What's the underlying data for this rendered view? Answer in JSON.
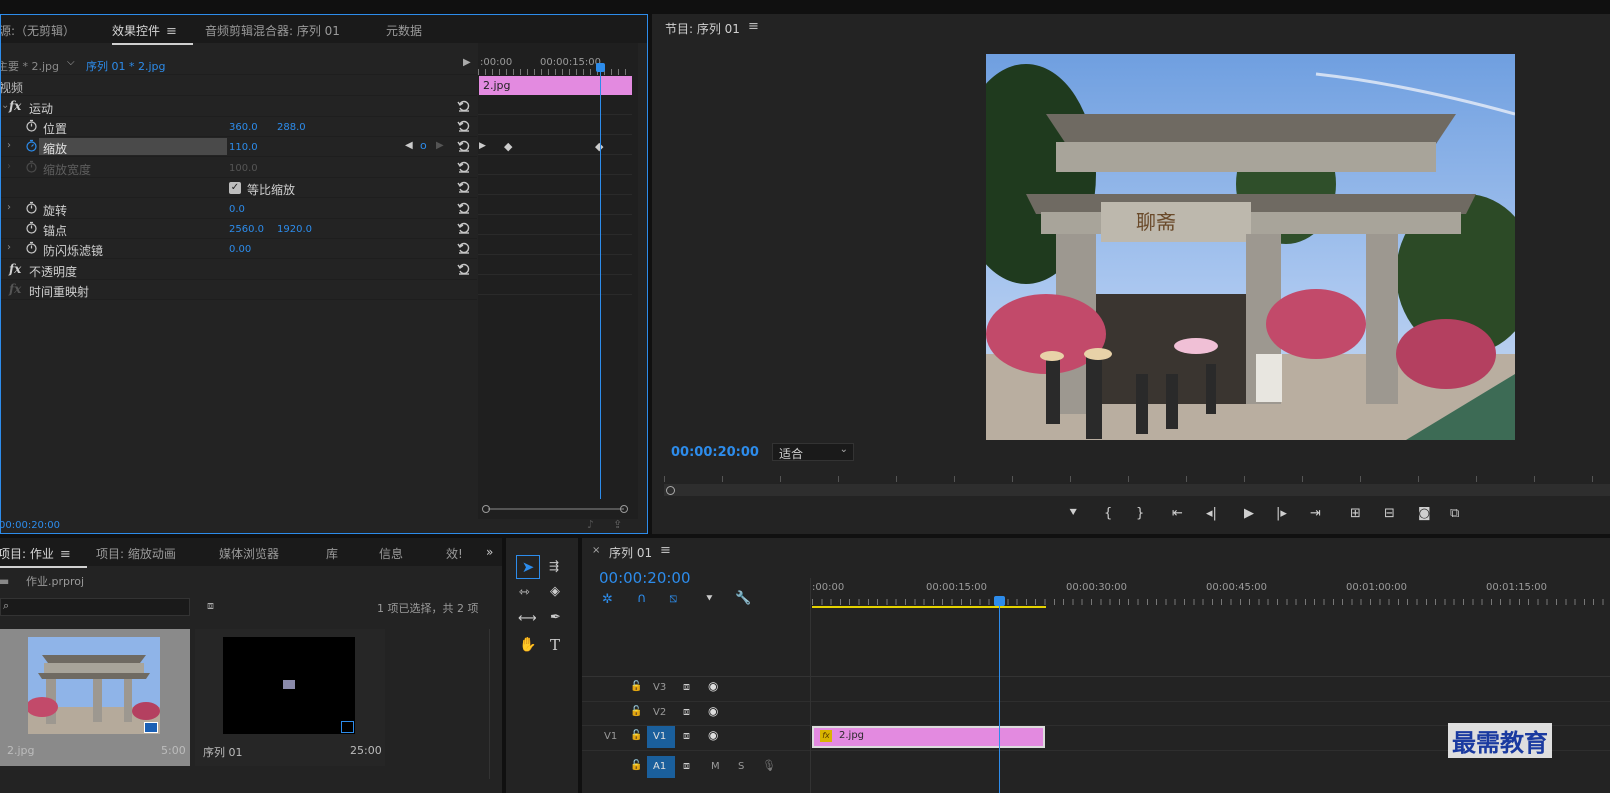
{
  "effect_panel": {
    "tabs": [
      "源:（无剪辑）",
      "效果控件",
      "音频剪辑混合器: 序列 01",
      "元数据"
    ],
    "source_clip": "主要 * 2.jpg",
    "sequence_clip": "序列 01 * 2.jpg",
    "section_video": "视频",
    "ruler_start": ":00:00",
    "ruler_mid": "00:00:15:00",
    "clip_label": "2.jpg",
    "timecode": "00:00:20:00",
    "props": {
      "motion": "运动",
      "position": "位置",
      "position_x": "360.0",
      "position_y": "288.0",
      "scale": "缩放",
      "scale_val": "110.0",
      "scale_width": "缩放宽度",
      "scale_width_val": "100.0",
      "uniform_scale": "等比缩放",
      "rotation": "旋转",
      "rotation_val": "0.0",
      "anchor": "锚点",
      "anchor_x": "2560.0",
      "anchor_y": "1920.0",
      "flicker": "防闪烁滤镜",
      "flicker_val": "0.00",
      "opacity": "不透明度",
      "time_remap": "时间重映射",
      "fx": "fx"
    }
  },
  "program": {
    "title": "节目: 序列 01",
    "timecode": "00:00:20:00",
    "fit": "适合",
    "sign_text": "聊斋"
  },
  "project": {
    "tabs": [
      "项目: 作业",
      "项目: 缩放动画",
      "媒体浏览器",
      "库",
      "信息",
      "效!"
    ],
    "file": "作业.prproj",
    "selection_info": "1 项已选择，共 2 项",
    "items": [
      {
        "name": "2.jpg",
        "duration": "5:00"
      },
      {
        "name": "序列 01",
        "duration": "25:00"
      }
    ]
  },
  "timeline": {
    "title": "序列 01",
    "timecode": "00:00:20:00",
    "ruler": [
      ":00:00",
      "00:00:15:00",
      "00:00:30:00",
      "00:00:45:00",
      "00:01:00:00",
      "00:01:15:00"
    ],
    "tracks": [
      "V3",
      "V2",
      "V1",
      "A1"
    ],
    "source_patch": "V1",
    "clip_label": "2.jpg",
    "fx_badge": "fx",
    "m": "M",
    "s": "S"
  },
  "watermark": "最需教育",
  "colors": {
    "accent": "#2d8ceb",
    "clip": "#e38ae0",
    "panel_bg": "#232323",
    "work_area": "#e5d300"
  }
}
